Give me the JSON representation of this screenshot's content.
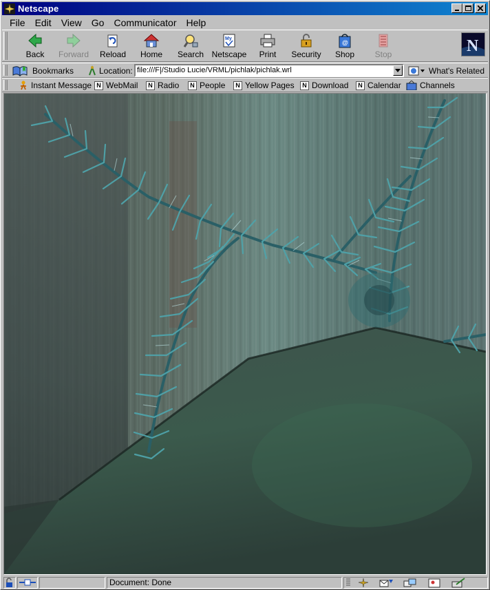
{
  "window": {
    "title": "Netscape"
  },
  "menubar": {
    "items": [
      {
        "label": "File"
      },
      {
        "label": "Edit"
      },
      {
        "label": "View"
      },
      {
        "label": "Go"
      },
      {
        "label": "Communicator"
      },
      {
        "label": "Help"
      }
    ]
  },
  "nav_toolbar": {
    "buttons": [
      {
        "label": "Back",
        "icon": "back-arrow-icon",
        "enabled": true
      },
      {
        "label": "Forward",
        "icon": "forward-arrow-icon",
        "enabled": false
      },
      {
        "label": "Reload",
        "icon": "reload-icon",
        "enabled": true
      },
      {
        "label": "Home",
        "icon": "home-icon",
        "enabled": true
      },
      {
        "label": "Search",
        "icon": "search-icon",
        "enabled": true
      },
      {
        "label": "Netscape",
        "icon": "my-netscape-icon",
        "enabled": true
      },
      {
        "label": "Print",
        "icon": "printer-icon",
        "enabled": true
      },
      {
        "label": "Security",
        "icon": "padlock-icon",
        "enabled": true
      },
      {
        "label": "Shop",
        "icon": "shop-bag-icon",
        "enabled": true
      },
      {
        "label": "Stop",
        "icon": "stop-icon",
        "enabled": false
      }
    ]
  },
  "location_toolbar": {
    "bookmarks_label": "Bookmarks",
    "location_label": "Location:",
    "url": "file:///F|/Studio Lucie/VRML/pichlak/pichlak.wrl",
    "related_label": "What's Related"
  },
  "personal_toolbar": {
    "items": [
      {
        "label": "Instant Message"
      },
      {
        "label": "WebMail"
      },
      {
        "label": "Radio"
      },
      {
        "label": "People"
      },
      {
        "label": "Yellow Pages"
      },
      {
        "label": "Download"
      },
      {
        "label": "Calendar"
      },
      {
        "label": "Channels"
      }
    ]
  },
  "status": {
    "text": "Document: Done"
  },
  "colors": {
    "title_start": "#000080",
    "title_end": "#1084d0",
    "chrome": "#c0c0c0",
    "scene_branch": "#3f8f96",
    "scene_floor": "#3c5a4e"
  }
}
